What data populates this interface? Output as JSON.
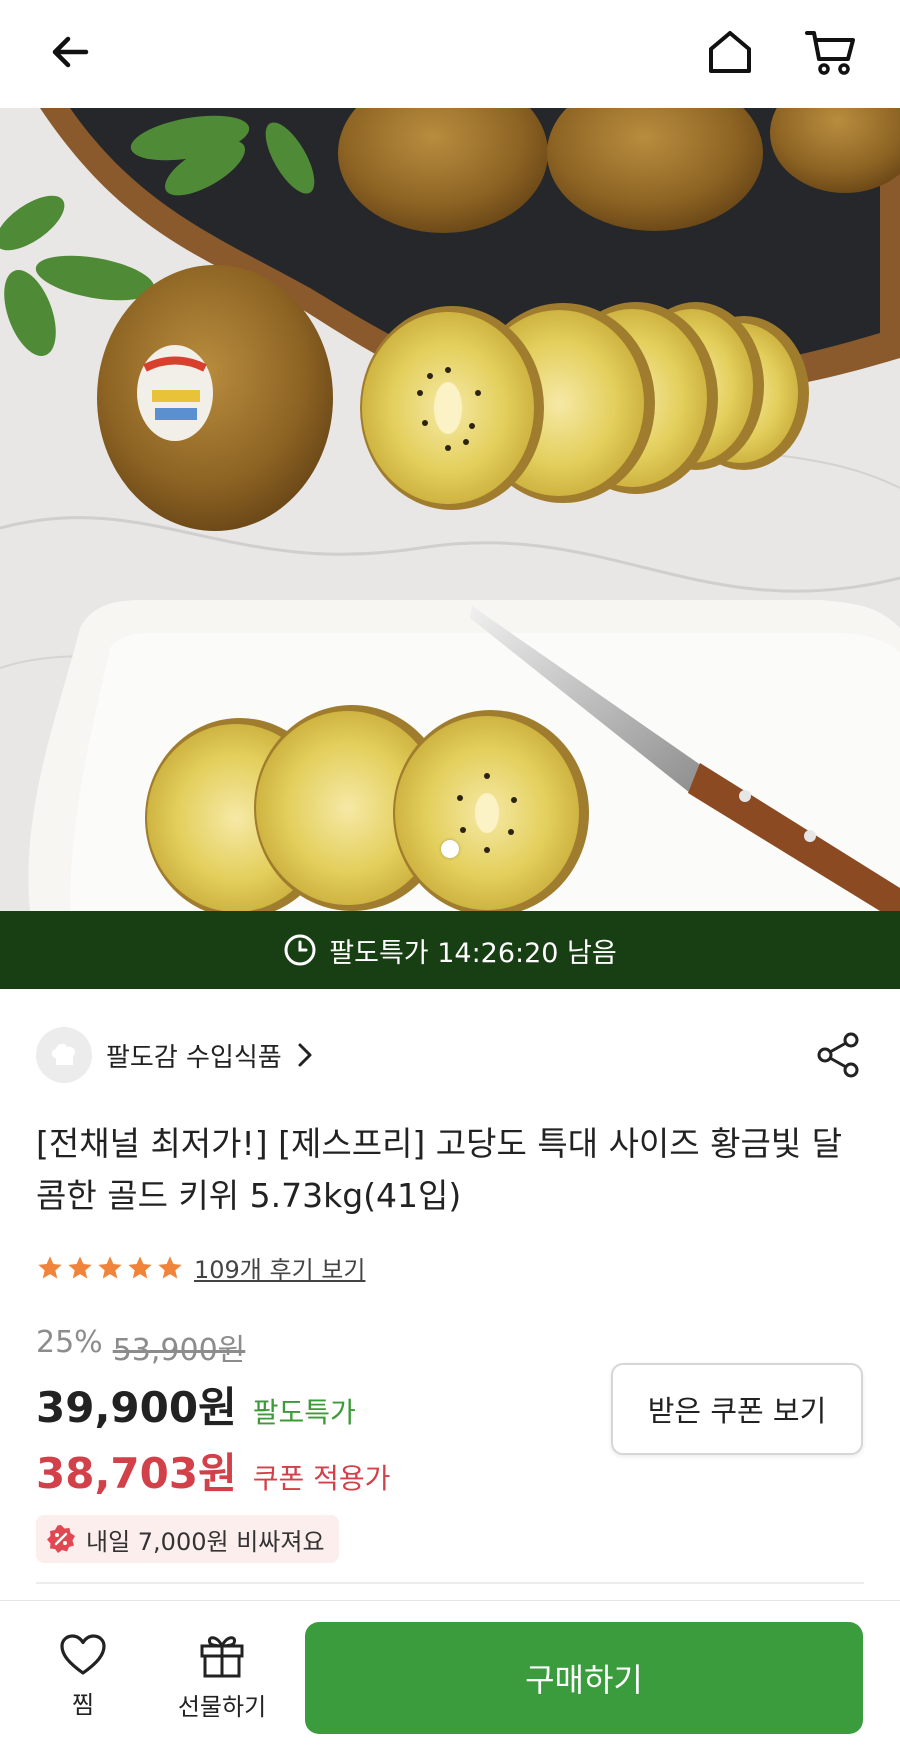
{
  "header": {
    "back_icon": "arrow-left-icon",
    "home_icon": "home-icon",
    "cart_icon": "cart-icon"
  },
  "hero": {
    "image_subject": "golden kiwi",
    "carousel_active_index": 0,
    "carousel_dot_count": 1
  },
  "timer": {
    "text": "팔도특가 14:26:20 남음",
    "icon": "clock-icon"
  },
  "seller": {
    "name": "팔도감 수입식품",
    "share_icon": "share-icon"
  },
  "product": {
    "title": "[전채널 최저가!] [제스프리] 고당도 특대 사이즈 황금빛 달콤한 골드 키위 5.73kg(41입)",
    "rating_stars": 5,
    "review_link": "109개 후기 보기"
  },
  "pricing": {
    "discount_rate": "25%",
    "original_price": "53,900원",
    "price": "39,900원",
    "price_label": "팔도특가",
    "coupon_price": "38,703원",
    "coupon_label": "쿠폰 적용가",
    "coupon_button": "받은 쿠폰 보기",
    "warning": "내일 7,000원 비싸져요"
  },
  "bottom_bar": {
    "like_label": "찜",
    "gift_label": "선물하기",
    "buy_label": "구매하기"
  },
  "colors": {
    "timer_bg": "#173f13",
    "buy_green": "#3b9c3d",
    "accent_green": "#3d9a38",
    "coupon_red": "#d2404a",
    "star_orange": "#f0843a"
  }
}
